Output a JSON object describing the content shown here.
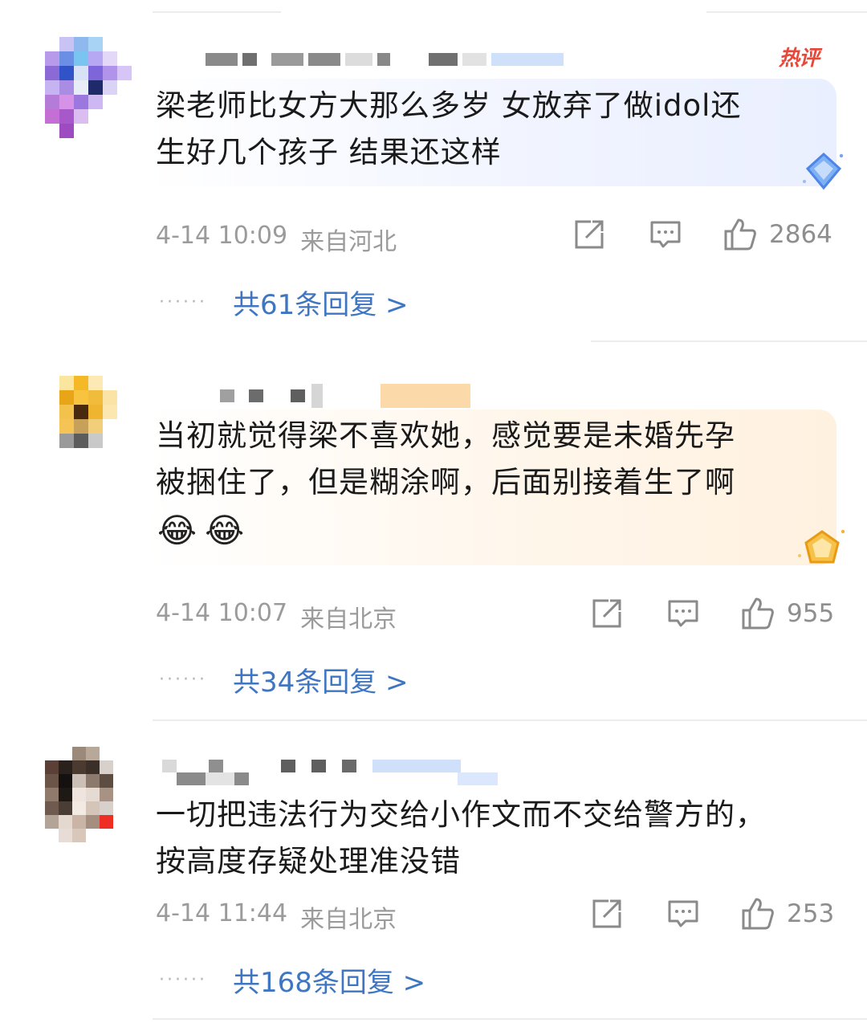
{
  "comments": [
    {
      "text": "梁老师比女方大那么多岁 女放弃了做idol还\n生好几个孩子 结果还这样",
      "date": "4-14 10:09",
      "location": "来自河北",
      "likes": "2864",
      "replies": "共61条回复 >",
      "badge": "热评",
      "bubble_theme": "blue"
    },
    {
      "text": "当初就觉得梁不喜欢她，感觉要是未婚先孕\n被捆住了，但是糊涂啊，后面别接着生了啊",
      "emoji": "😂😂",
      "date": "4-14 10:07",
      "location": "来自北京",
      "likes": "955",
      "replies": "共34条回复 >",
      "bubble_theme": "orange"
    },
    {
      "text": "一切把违法行为交给小作文而不交给警方的，\n按高度存疑处理准没错",
      "date": "4-14 11:44",
      "location": "来自北京",
      "likes": "253",
      "replies": "共168条回复 >"
    }
  ],
  "icons": {
    "share": "share-icon",
    "comment": "comment-icon",
    "like": "thumbs-up-icon",
    "gem": "gem-icon"
  },
  "colors": {
    "link": "#3f76c2",
    "meta": "#9b9b9b",
    "hot": "#e8483a"
  }
}
